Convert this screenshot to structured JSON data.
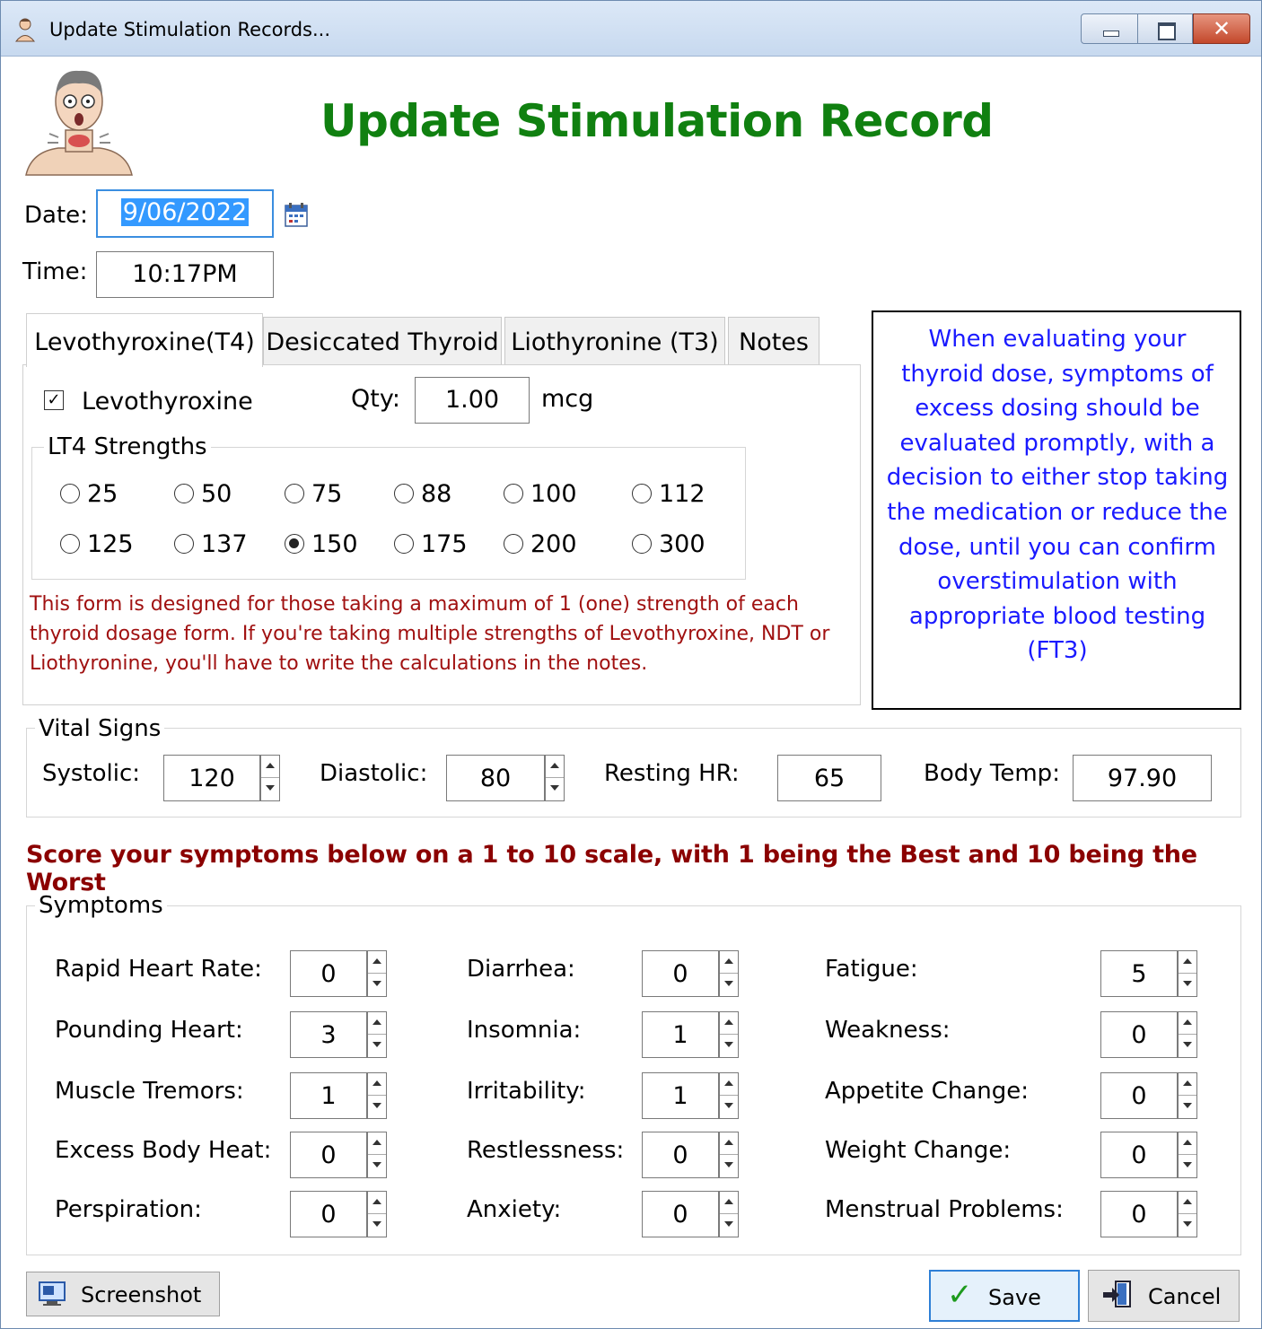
{
  "window": {
    "title": "Update Stimulation Records...",
    "close_glyph": "✕"
  },
  "header": {
    "title": "Update Stimulation Record",
    "title_color": "#108010"
  },
  "form": {
    "date_label": "Date:",
    "date_value": "9/06/2022",
    "time_label": "Time:",
    "time_value": "10:17PM"
  },
  "tabs": [
    {
      "label": "Levothyroxine(T4)",
      "active": true
    },
    {
      "label": "Desiccated Thyroid",
      "active": false
    },
    {
      "label": "Liothyronine (T3)",
      "active": false
    },
    {
      "label": "Notes",
      "active": false
    }
  ],
  "levothyroxine": {
    "checkbox_label": "Levothyroxine",
    "checked": true,
    "check_glyph": "✓",
    "qty_label": "Qty:",
    "qty_value": "1.00",
    "unit": "mcg",
    "strengths_label": "LT4 Strengths",
    "strengths": [
      "25",
      "50",
      "75",
      "88",
      "100",
      "112",
      "125",
      "137",
      "150",
      "175",
      "200",
      "300"
    ],
    "selected_strength": "150"
  },
  "disclaimer": "This form is designed for those taking a maximum of 1 (one) strength of each thyroid dosage form. If you're taking multiple strengths of Levothyroxine, NDT or Liothyronine, you'll have to write the calculations in the notes.",
  "info_box": "When evaluating your thyroid dose, symptoms of excess dosing should be evaluated promptly, with a decision to either stop taking the medication or reduce the dose, until you can confirm overstimulation with appropriate blood testing (FT3)",
  "vitals": {
    "group_label": "Vital Signs",
    "systolic_label": "Systolic:",
    "systolic": "120",
    "diastolic_label": "Diastolic:",
    "diastolic": "80",
    "hr_label": "Resting HR:",
    "hr": "65",
    "temp_label": "Body Temp:",
    "temp": "97.90"
  },
  "score_banner": "Score your symptoms below on a 1 to 10 scale, with 1 being the Best and 10 being the Worst",
  "symptoms": {
    "group_label": "Symptoms",
    "col1": [
      {
        "label": "Rapid Heart Rate:",
        "value": "0"
      },
      {
        "label": "Pounding Heart:",
        "value": "3"
      },
      {
        "label": "Muscle Tremors:",
        "value": "1"
      },
      {
        "label": "Excess Body Heat:",
        "value": "0"
      },
      {
        "label": "Perspiration:",
        "value": "0"
      }
    ],
    "col2": [
      {
        "label": "Diarrhea:",
        "value": "0"
      },
      {
        "label": "Insomnia:",
        "value": "1"
      },
      {
        "label": "Irritability:",
        "value": "1"
      },
      {
        "label": "Restlessness:",
        "value": "0"
      },
      {
        "label": "Anxiety:",
        "value": "0"
      }
    ],
    "col3": [
      {
        "label": "Fatigue:",
        "value": "5"
      },
      {
        "label": "Weakness:",
        "value": "0"
      },
      {
        "label": "Appetite Change:",
        "value": "0"
      },
      {
        "label": "Weight Change:",
        "value": "0"
      },
      {
        "label": "Menstrual Problems:",
        "value": "0"
      }
    ]
  },
  "buttons": {
    "screenshot": "Screenshot",
    "save": "Save",
    "save_glyph": "✓",
    "cancel": "Cancel"
  }
}
